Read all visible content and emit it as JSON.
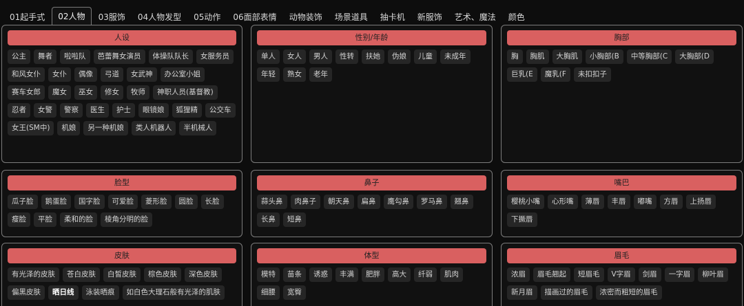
{
  "tabs": [
    {
      "label": "01起手式",
      "active": false
    },
    {
      "label": "02人物",
      "active": true
    },
    {
      "label": "03服饰",
      "active": false
    },
    {
      "label": "04人物发型",
      "active": false
    },
    {
      "label": "05动作",
      "active": false
    },
    {
      "label": "06面部表情",
      "active": false
    },
    {
      "label": "动物装饰",
      "active": false
    },
    {
      "label": "场景道具",
      "active": false
    },
    {
      "label": "抽卡机",
      "active": false
    },
    {
      "label": "新服饰",
      "active": false
    },
    {
      "label": "艺术、魔法",
      "active": false
    },
    {
      "label": "颜色",
      "active": false
    }
  ],
  "panels": [
    {
      "title": "人设",
      "items": [
        "公主",
        "舞者",
        "啦啦队",
        "芭蕾舞女演员",
        "体操队队长",
        "女服务员",
        "和风女仆",
        "女仆",
        "偶像",
        "弓道",
        "女武神",
        "办公室小姐",
        "赛车女郎",
        "魔女",
        "巫女",
        "修女",
        "牧师",
        "神职人员(基督教)",
        "忍者",
        "女警",
        "警察",
        "医生",
        "护士",
        "眼镜娘",
        "狐狸精",
        "公交车",
        "女王(SM中)",
        "机娘",
        "另一种机娘",
        "类人机器人",
        "半机械人"
      ]
    },
    {
      "title": "性别/年龄",
      "items": [
        "单人",
        "女人",
        "男人",
        "性转",
        "扶她",
        "伪娘",
        "儿童",
        "未成年",
        "年轻",
        "熟女",
        "老年"
      ]
    },
    {
      "title": "胸部",
      "items": [
        "胸",
        "胸肌",
        "大胸肌",
        "小胸部(B",
        "中等胸部(C",
        "大胸部(D",
        "巨乳(E",
        "魔乳(F",
        "未扣扣子"
      ]
    },
    {
      "title": "脸型",
      "items": [
        "瓜子脸",
        "鹅蛋脸",
        "国字脸",
        "可爱脸",
        "菱形脸",
        "圆脸",
        "长脸",
        "瘦脸",
        "平脸",
        "柔和的脸",
        "棱角分明的脸"
      ]
    },
    {
      "title": "鼻子",
      "items": [
        "蒜头鼻",
        "肉鼻子",
        "朝天鼻",
        "扁鼻",
        "鹰勾鼻",
        "罗马鼻",
        "翘鼻",
        "长鼻",
        "短鼻"
      ]
    },
    {
      "title": "嘴巴",
      "items": [
        "樱桃小嘴",
        "心形嘴",
        "薄唇",
        "丰唇",
        "嘟嘴",
        "方唇",
        "上扬唇",
        "下撅唇"
      ]
    },
    {
      "title": "皮肤",
      "items": [
        "有光泽的皮肤",
        "苍白皮肤",
        "白皙皮肤",
        "棕色皮肤",
        "深色皮肤",
        "偏黑皮肤",
        "晒日线",
        "泳装晒痕",
        "如白色大理石般有光泽的肌肤"
      ]
    },
    {
      "title": "体型",
      "items": [
        "模特",
        "苗条",
        "诱惑",
        "丰满",
        "肥胖",
        "高大",
        "纤弱",
        "肌肉",
        "细腰",
        "宽臀"
      ]
    },
    {
      "title": "眉毛",
      "items": [
        "浓眉",
        "眉毛翘起",
        "短眉毛",
        "V字眉",
        "剑眉",
        "一字眉",
        "柳叶眉",
        "新月眉",
        "描画过的眉毛",
        "浓密而粗短的眉毛"
      ]
    }
  ]
}
